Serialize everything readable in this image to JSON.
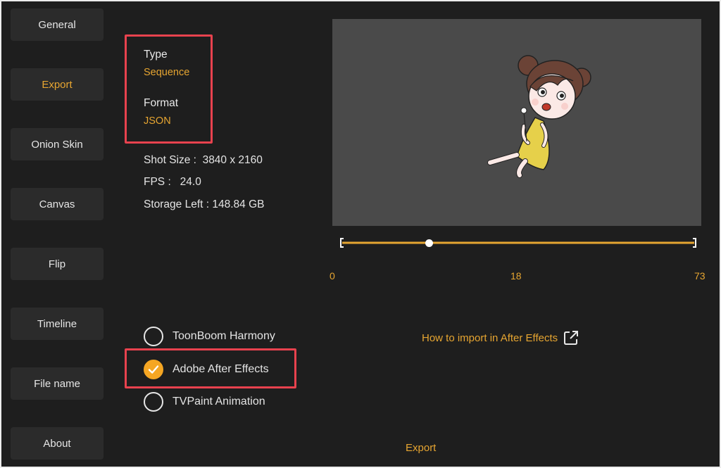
{
  "sidebar": {
    "items": [
      {
        "label": "General"
      },
      {
        "label": "Export"
      },
      {
        "label": "Onion Skin"
      },
      {
        "label": "Canvas"
      },
      {
        "label": "Flip"
      },
      {
        "label": "Timeline"
      },
      {
        "label": "File name"
      },
      {
        "label": "About"
      }
    ],
    "active": "Export"
  },
  "export_settings": {
    "type_label": "Type",
    "type_value": "Sequence",
    "format_label": "Format",
    "format_value": "JSON",
    "shot_size": "Shot Size :  3840 x 2160",
    "fps": "FPS :   24.0",
    "storage": "Storage Left : 148.84 GB"
  },
  "timeline": {
    "start": "0",
    "current": "18",
    "end": "73",
    "progress": 0.247
  },
  "target_apps": {
    "options": [
      {
        "label": "ToonBoom Harmony",
        "checked": false
      },
      {
        "label": "Adobe After Effects",
        "checked": true
      },
      {
        "label": "TVPaint Animation",
        "checked": false
      }
    ]
  },
  "help_link": "How to import in After Effects",
  "export_button": "Export",
  "colors": {
    "accent": "#e6a531",
    "highlight_box": "#e8424e",
    "background": "#1e1e1e",
    "button_bg": "#2b2b2b",
    "preview_bg": "#4a4a4a"
  },
  "icons": {
    "checkmark": "check-icon",
    "external_link": "external-link-icon"
  }
}
